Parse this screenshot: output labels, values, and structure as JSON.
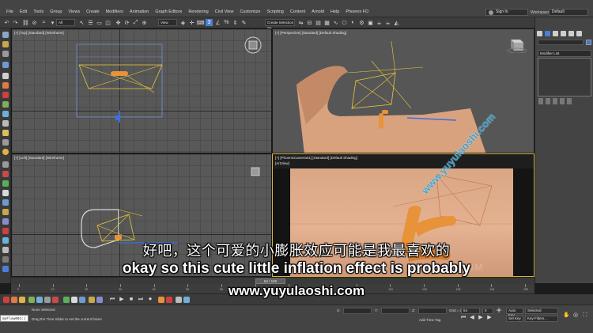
{
  "menu": {
    "items": [
      "File",
      "Edit",
      "Tools",
      "Group",
      "Views",
      "Create",
      "Modifiers",
      "Animation",
      "Graph Editors",
      "Rendering",
      "Civil View",
      "Customize",
      "Scripting",
      "Content",
      "Arnold",
      "Help",
      "Phoenix FD"
    ],
    "signin_label": "Sign In",
    "workspace_label": "Workspaces:",
    "workspace_value": "Default"
  },
  "toolbar": {
    "filter_value": "All",
    "view_value": "View",
    "selection_set_value": "Create Selection Se",
    "snap_label": "3"
  },
  "viewports": {
    "top_label": "[+] [Top] [Standard] [Wireframe]",
    "perspective_label": "[+] [Perspective] [Standard] [Default Shading]",
    "left_label": "[+] [Left] [Standard] [Wireframe]",
    "camera_label": "[+] [PhoenixCamera01] [Standard] [Default Shading]",
    "camera_sublabel": "[ArtView]"
  },
  "command_panel": {
    "modifier_list": "Modifier List",
    "accent_color": "#3e7bd6"
  },
  "timeline": {
    "frame_display": "64 / 150",
    "ticks": [
      "0",
      "10",
      "20",
      "30",
      "40",
      "50",
      "60",
      "70",
      "80",
      "90",
      "100",
      "110",
      "120",
      "130",
      "140",
      "150"
    ]
  },
  "status": {
    "maxscript": "myFlow001:{",
    "selection": "None Selected",
    "prompt": "Drag the Time Slider to set the current frame",
    "x_label": "X:",
    "y_label": "Y:",
    "z_label": "Z:",
    "grid": "Grid = 10.0cm",
    "add_time_tag": "Add Time Tag",
    "auto_key": "Auto Key",
    "set_key": "Set Key",
    "selected": "Selected",
    "key_filters": "Key Filters...",
    "frame": "64",
    "frame_end": "0"
  },
  "subtitles": {
    "chinese": "好吧，这个可爱的小膨胀效应可能是我最喜欢的",
    "english": "okay so this cute little inflation effect is probably",
    "url": "www.yuyulaoshi.com"
  },
  "watermark": {
    "diagonal": "www.yuyulaoshi.com",
    "faint": "OM"
  },
  "colors": {
    "terracotta": "#d9a27f",
    "orange_object": "#e8923a",
    "wire_yellow": "#e8c838",
    "active_border": "#d8b33a",
    "axis_blue": "#3a6fe0"
  }
}
